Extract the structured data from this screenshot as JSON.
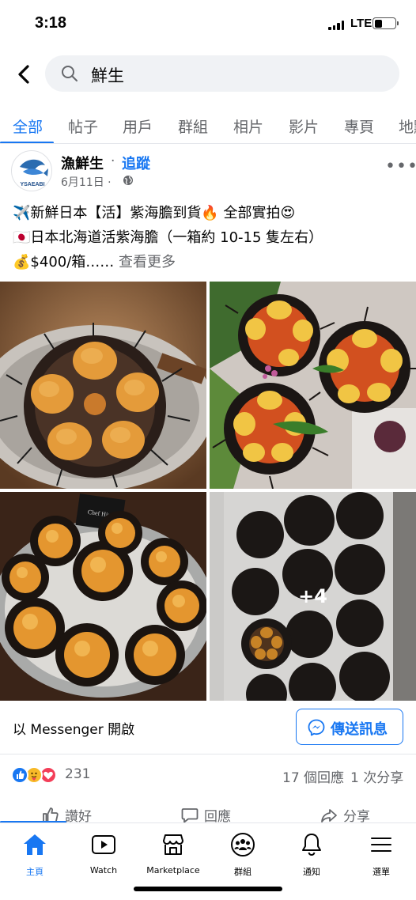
{
  "status_bar": {
    "time": "3:18",
    "network": "LTE"
  },
  "search": {
    "query": "鮮生"
  },
  "tabs": [
    {
      "label": "全部",
      "active": true
    },
    {
      "label": "帖子"
    },
    {
      "label": "用戶"
    },
    {
      "label": "群組"
    },
    {
      "label": "相片"
    },
    {
      "label": "影片"
    },
    {
      "label": "專頁"
    },
    {
      "label": "地點"
    }
  ],
  "post": {
    "avatar_text": "YSAEABI",
    "author": "漁鮮生",
    "separator": "·",
    "follow_label": "追蹤",
    "date": "6月11日 ·",
    "lines": [
      "✈️新鮮日本【活】紫海膽到貨🔥 全部實拍😍",
      "🇯🇵日本北海道活紫海膽（一箱約 10-15 隻左右）",
      "💰$400/箱……"
    ],
    "see_more": "查看更多",
    "extra_photos": "+4",
    "photo_sign": "Chef Hiro"
  },
  "messenger": {
    "prompt": "以 Messenger 開啟",
    "send_label": "傳送訊息"
  },
  "engagement": {
    "reaction_count": "231",
    "comments": "17 個回應",
    "shares": "1 次分享"
  },
  "actions": {
    "like": "讚好",
    "comment": "回應",
    "share": "分享"
  },
  "nav": [
    {
      "label": "主頁",
      "active": true
    },
    {
      "label": "Watch"
    },
    {
      "label": "Marketplace"
    },
    {
      "label": "群組"
    },
    {
      "label": "通知"
    },
    {
      "label": "選單"
    }
  ],
  "colors": {
    "accent": "#1877f2",
    "secondary_text": "#65676b",
    "search_bg": "#f0f2f5"
  }
}
